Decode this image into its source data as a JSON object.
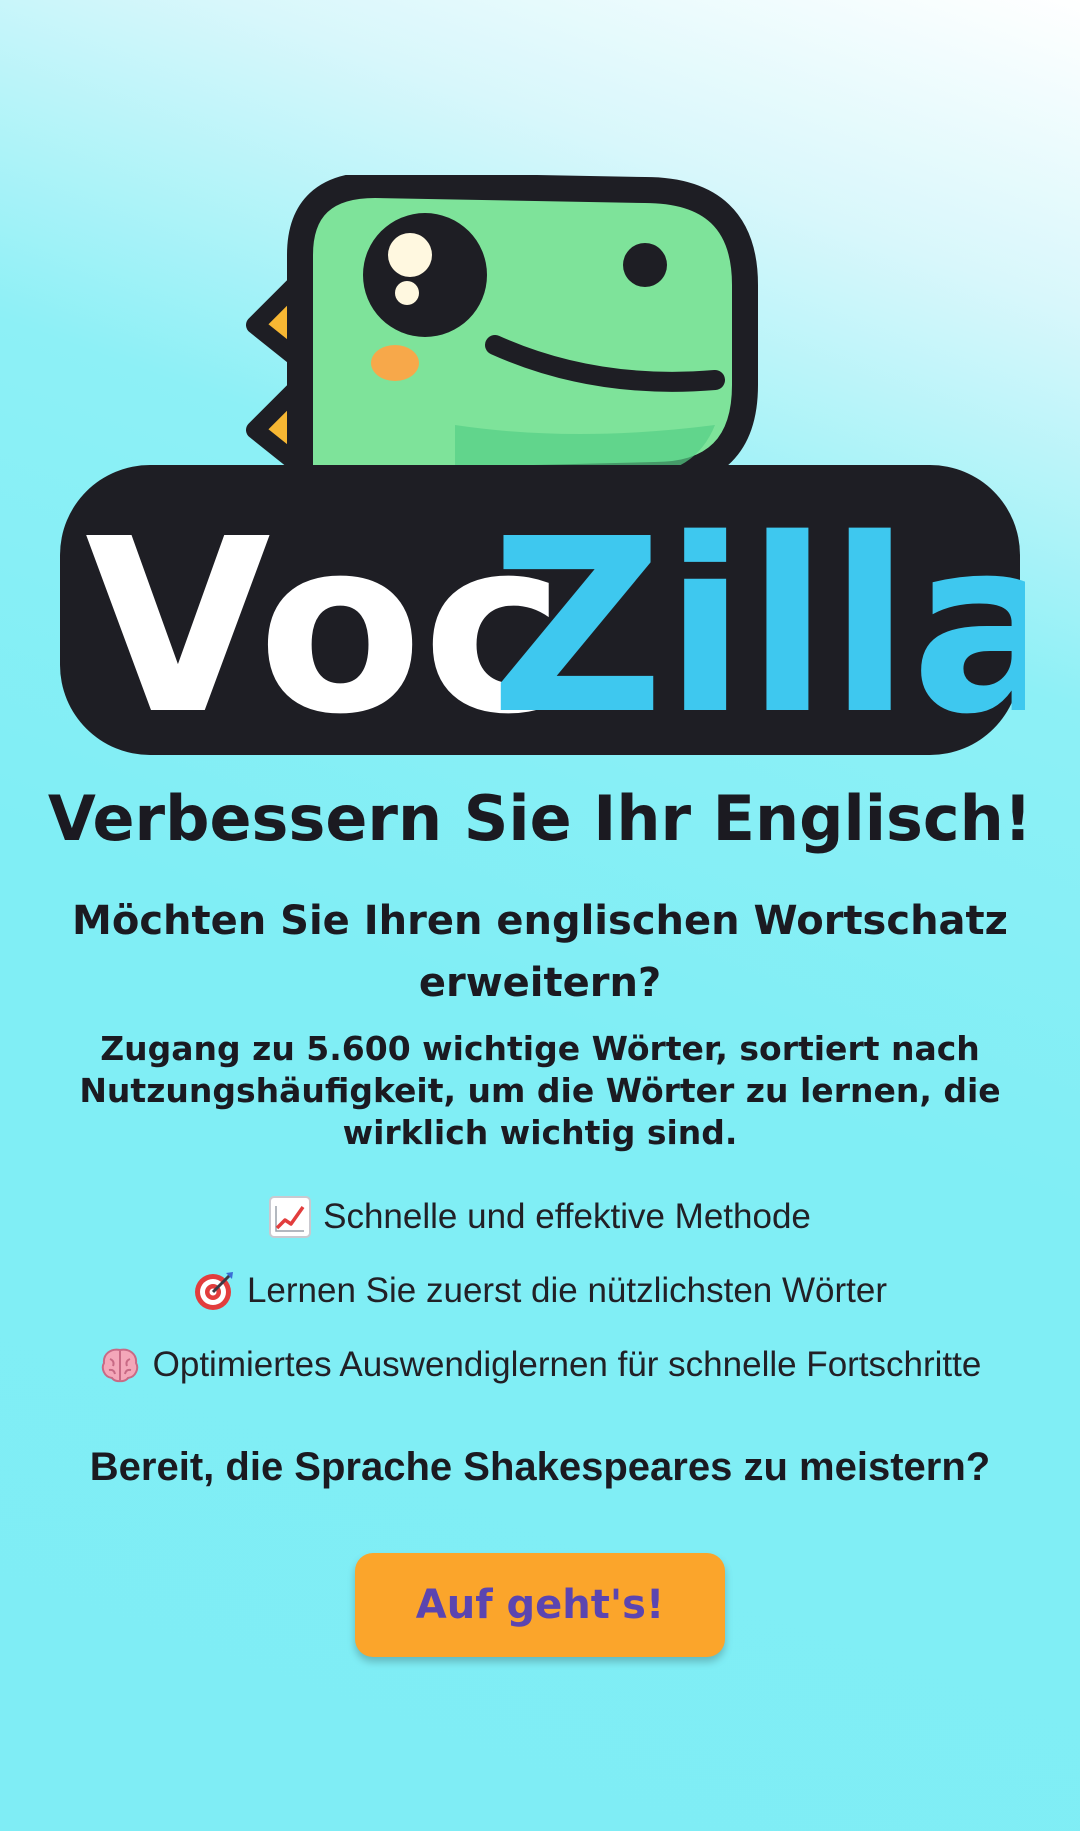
{
  "logo": {
    "word_part1": "Voc",
    "word_part2": "Zilla",
    "mascot": "dinosaur-mascot",
    "colors": {
      "dino_green": "#7ee39a",
      "outline": "#1e1e24",
      "spikes": "#f7b733",
      "zilla_blue": "#3ec8ef",
      "voc_white": "#ffffff"
    }
  },
  "headline": "Verbessern Sie Ihr Englisch!",
  "subtitle": "Möchten Sie Ihren englischen Wortschatz erweitern?",
  "description": "Zugang zu 5.600 wichtige Wörter, sortiert nach Nutzungshäufigkeit, um die Wörter zu lernen, die wirklich wichtig sind.",
  "features": [
    {
      "icon": "chart-increasing-icon",
      "text": "Schnelle und effektive Methode"
    },
    {
      "icon": "target-icon",
      "text": "Lernen Sie zuerst die nützlichsten Wörter"
    },
    {
      "icon": "brain-icon",
      "text": "Optimiertes Auswendiglernen für schnelle Fortschritte"
    }
  ],
  "ready_text": "Bereit, die Sprache Shakespeares zu meistern?",
  "cta_label": "Auf geht's!",
  "colors": {
    "background": "#80eef5",
    "cta_background": "#fba52b",
    "cta_text": "#5b45b0",
    "text": "#1b1a21"
  }
}
